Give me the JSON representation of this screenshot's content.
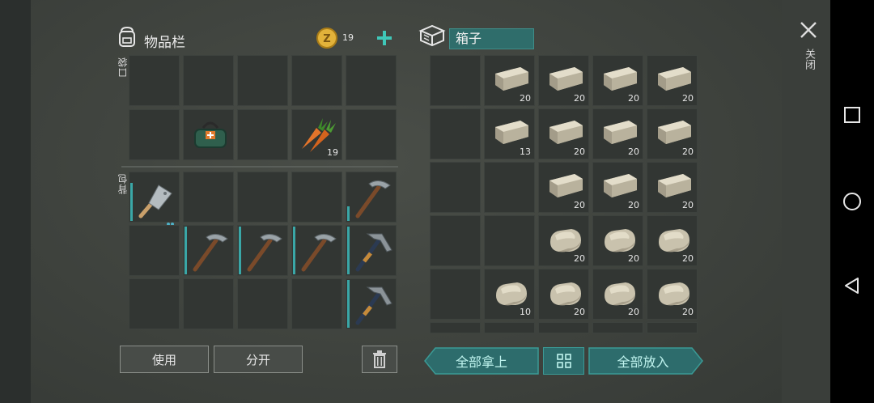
{
  "inventory": {
    "title": "物品栏",
    "coins": "19",
    "pocket_label": "口袋",
    "backpack_label": "背包",
    "pocket_items": [
      {
        "row": 1,
        "col": 1,
        "icon": "first-aid-bag-icon",
        "qty": ""
      },
      {
        "row": 1,
        "col": 3,
        "icon": "carrot-icon",
        "qty": "19"
      }
    ],
    "backpack_items": [
      {
        "row": 0,
        "col": 0,
        "icon": "cleaver-icon",
        "qty": "",
        "durability": 0.8
      },
      {
        "row": 0,
        "col": 4,
        "icon": "pickaxe-icon",
        "qty": "",
        "durability": 0.3
      },
      {
        "row": 1,
        "col": 1,
        "icon": "pickaxe-icon",
        "qty": "",
        "durability": 1
      },
      {
        "row": 1,
        "col": 2,
        "icon": "pickaxe-icon",
        "qty": "",
        "durability": 1
      },
      {
        "row": 1,
        "col": 3,
        "icon": "pickaxe-icon",
        "qty": "",
        "durability": 1
      },
      {
        "row": 1,
        "col": 4,
        "icon": "iron-pickaxe-icon",
        "qty": "",
        "durability": 1
      },
      {
        "row": 2,
        "col": 4,
        "icon": "iron-pickaxe-icon",
        "qty": "",
        "durability": 1
      }
    ],
    "use_button": "使用",
    "split_button": "分开"
  },
  "box": {
    "title": "箱子",
    "items": [
      {
        "row": 0,
        "col": 1,
        "icon": "stone-brick-icon",
        "qty": "20"
      },
      {
        "row": 0,
        "col": 2,
        "icon": "stone-brick-icon",
        "qty": "20"
      },
      {
        "row": 0,
        "col": 3,
        "icon": "stone-brick-icon",
        "qty": "20"
      },
      {
        "row": 0,
        "col": 4,
        "icon": "stone-brick-icon",
        "qty": "20"
      },
      {
        "row": 1,
        "col": 1,
        "icon": "stone-brick-icon",
        "qty": "13"
      },
      {
        "row": 1,
        "col": 2,
        "icon": "stone-brick-icon",
        "qty": "20"
      },
      {
        "row": 1,
        "col": 3,
        "icon": "stone-brick-icon",
        "qty": "20"
      },
      {
        "row": 1,
        "col": 4,
        "icon": "stone-brick-icon",
        "qty": "20"
      },
      {
        "row": 2,
        "col": 2,
        "icon": "stone-brick-icon",
        "qty": "20"
      },
      {
        "row": 2,
        "col": 3,
        "icon": "stone-brick-icon",
        "qty": "20"
      },
      {
        "row": 2,
        "col": 4,
        "icon": "stone-brick-icon",
        "qty": "20"
      },
      {
        "row": 3,
        "col": 2,
        "icon": "stone-icon",
        "qty": "20"
      },
      {
        "row": 3,
        "col": 3,
        "icon": "stone-icon",
        "qty": "20"
      },
      {
        "row": 3,
        "col": 4,
        "icon": "stone-icon",
        "qty": "20"
      },
      {
        "row": 4,
        "col": 1,
        "icon": "stone-icon",
        "qty": "10"
      },
      {
        "row": 4,
        "col": 2,
        "icon": "stone-icon",
        "qty": "20"
      },
      {
        "row": 4,
        "col": 3,
        "icon": "stone-icon",
        "qty": "20"
      },
      {
        "row": 4,
        "col": 4,
        "icon": "stone-icon",
        "qty": "20"
      }
    ],
    "take_all_button": "全部拿上",
    "put_all_button": "全部放入"
  },
  "close_label": "关闭",
  "colors": {
    "teal": "#2d6c6c",
    "durability": "#3aa7a7"
  }
}
